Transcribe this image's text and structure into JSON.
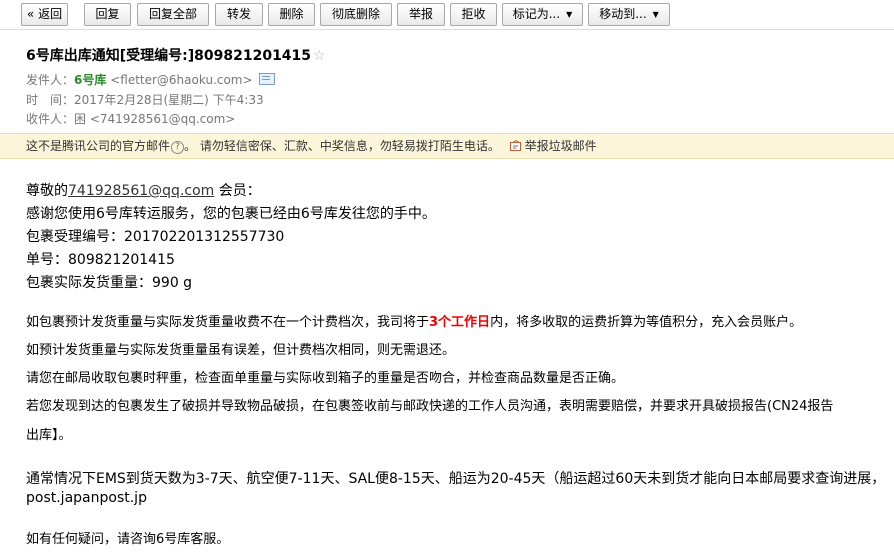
{
  "toolbar": {
    "back": "« 返回",
    "reply": "回复",
    "reply_all": "回复全部",
    "forward": "转发",
    "delete": "删除",
    "delete_forever": "彻底删除",
    "report": "举报",
    "reject": "拒收",
    "mark_as": "标记为...",
    "move_to": "移动到..."
  },
  "header": {
    "subject": "6号库出库通知[受理编号:]809821201415",
    "star": "☆",
    "from_label": "发件人：",
    "from_name": "6号库",
    "from_email": "<fletter@6haoku.com>",
    "time_label": "时　间：",
    "time_value": "2017年2月28日(星期二) 下午4:33",
    "to_label": "收件人：",
    "to_value": "困 <741928561@qq.com>"
  },
  "warning": {
    "text1": "这不是腾讯公司的官方邮件",
    "q": "?",
    "text2": "。 请勿轻信密保、汇款、中奖信息，勿轻易拨打陌生电话。",
    "report_link": "举报垃圾邮件"
  },
  "body": {
    "greet_prefix": "尊敬的",
    "greet_email": "741928561@qq.com",
    "greet_suffix": " 会员：",
    "thanks": "感谢您使用6号库转运服务，您的包裹已经由6号库发往您的手中。",
    "accept_no": "包裹受理编号：201702201312557730",
    "order_no": "单号：809821201415",
    "weight": "包裹实际发货重量：990 g",
    "p1_a": "如包裹预计发货重量与实际发货重量收费不在一个计费档次，我司将于",
    "p1_red": "3个工作日",
    "p1_b": "内，将多收取的运费折算为等值积分，充入会员账户。",
    "p2": "如预计发货重量与实际发货重量虽有误差，但计费档次相同，则无需退还。",
    "p3": "请您在邮局收取包裹时秤重，检查面单重量与实际收到箱子的重量是否吻合，并检查商品数量是否正确。",
    "p4": "若您发现到达的包裹发生了破损并导致物品破损，在包裹签收前与邮政快递的工作人员沟通，表明需要赔偿，并要求开具破损报告(CN24报告",
    "p4_cont": "出库】。",
    "p5": "通常情况下EMS到货天数为3-7天、航空便7-11天、SAL便8-15天、船运为20-45天（船运超过60天未到货才能向日本邮局要求查询进展，",
    "p5_link": "post.japanpost.jp",
    "p6": "如有任何疑问，请咨询6号库客服。"
  }
}
